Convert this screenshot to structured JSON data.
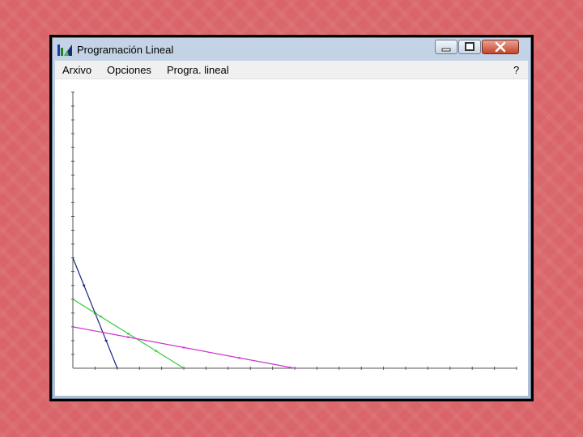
{
  "window": {
    "title": "Programación Lineal",
    "icon": "bar-chart-app-icon"
  },
  "title_buttons": {
    "minimize_icon": "minimize-icon",
    "maximize_icon": "maximize-icon",
    "close_icon": "close-icon"
  },
  "menu": {
    "items": [
      "Arxivo",
      "Opciones",
      "Progra. lineal"
    ],
    "help": "?"
  },
  "colors": {
    "desktop": "#d9656a",
    "line_navy": "#1a237e",
    "line_green": "#33cc33",
    "line_magenta": "#cc33cc",
    "axis": "#555555"
  },
  "chart_data": {
    "type": "line",
    "grid": false,
    "xlim": [
      0,
      20
    ],
    "ylim": [
      0,
      20
    ],
    "x_ticks": 20,
    "y_ticks": 20,
    "series": [
      {
        "color": "#1a237e",
        "points": [
          [
            0,
            8
          ],
          [
            2,
            0
          ]
        ]
      },
      {
        "color": "#33cc33",
        "points": [
          [
            0,
            5
          ],
          [
            5,
            0
          ]
        ]
      },
      {
        "color": "#cc33cc",
        "points": [
          [
            0,
            3
          ],
          [
            10,
            0
          ]
        ]
      }
    ]
  }
}
